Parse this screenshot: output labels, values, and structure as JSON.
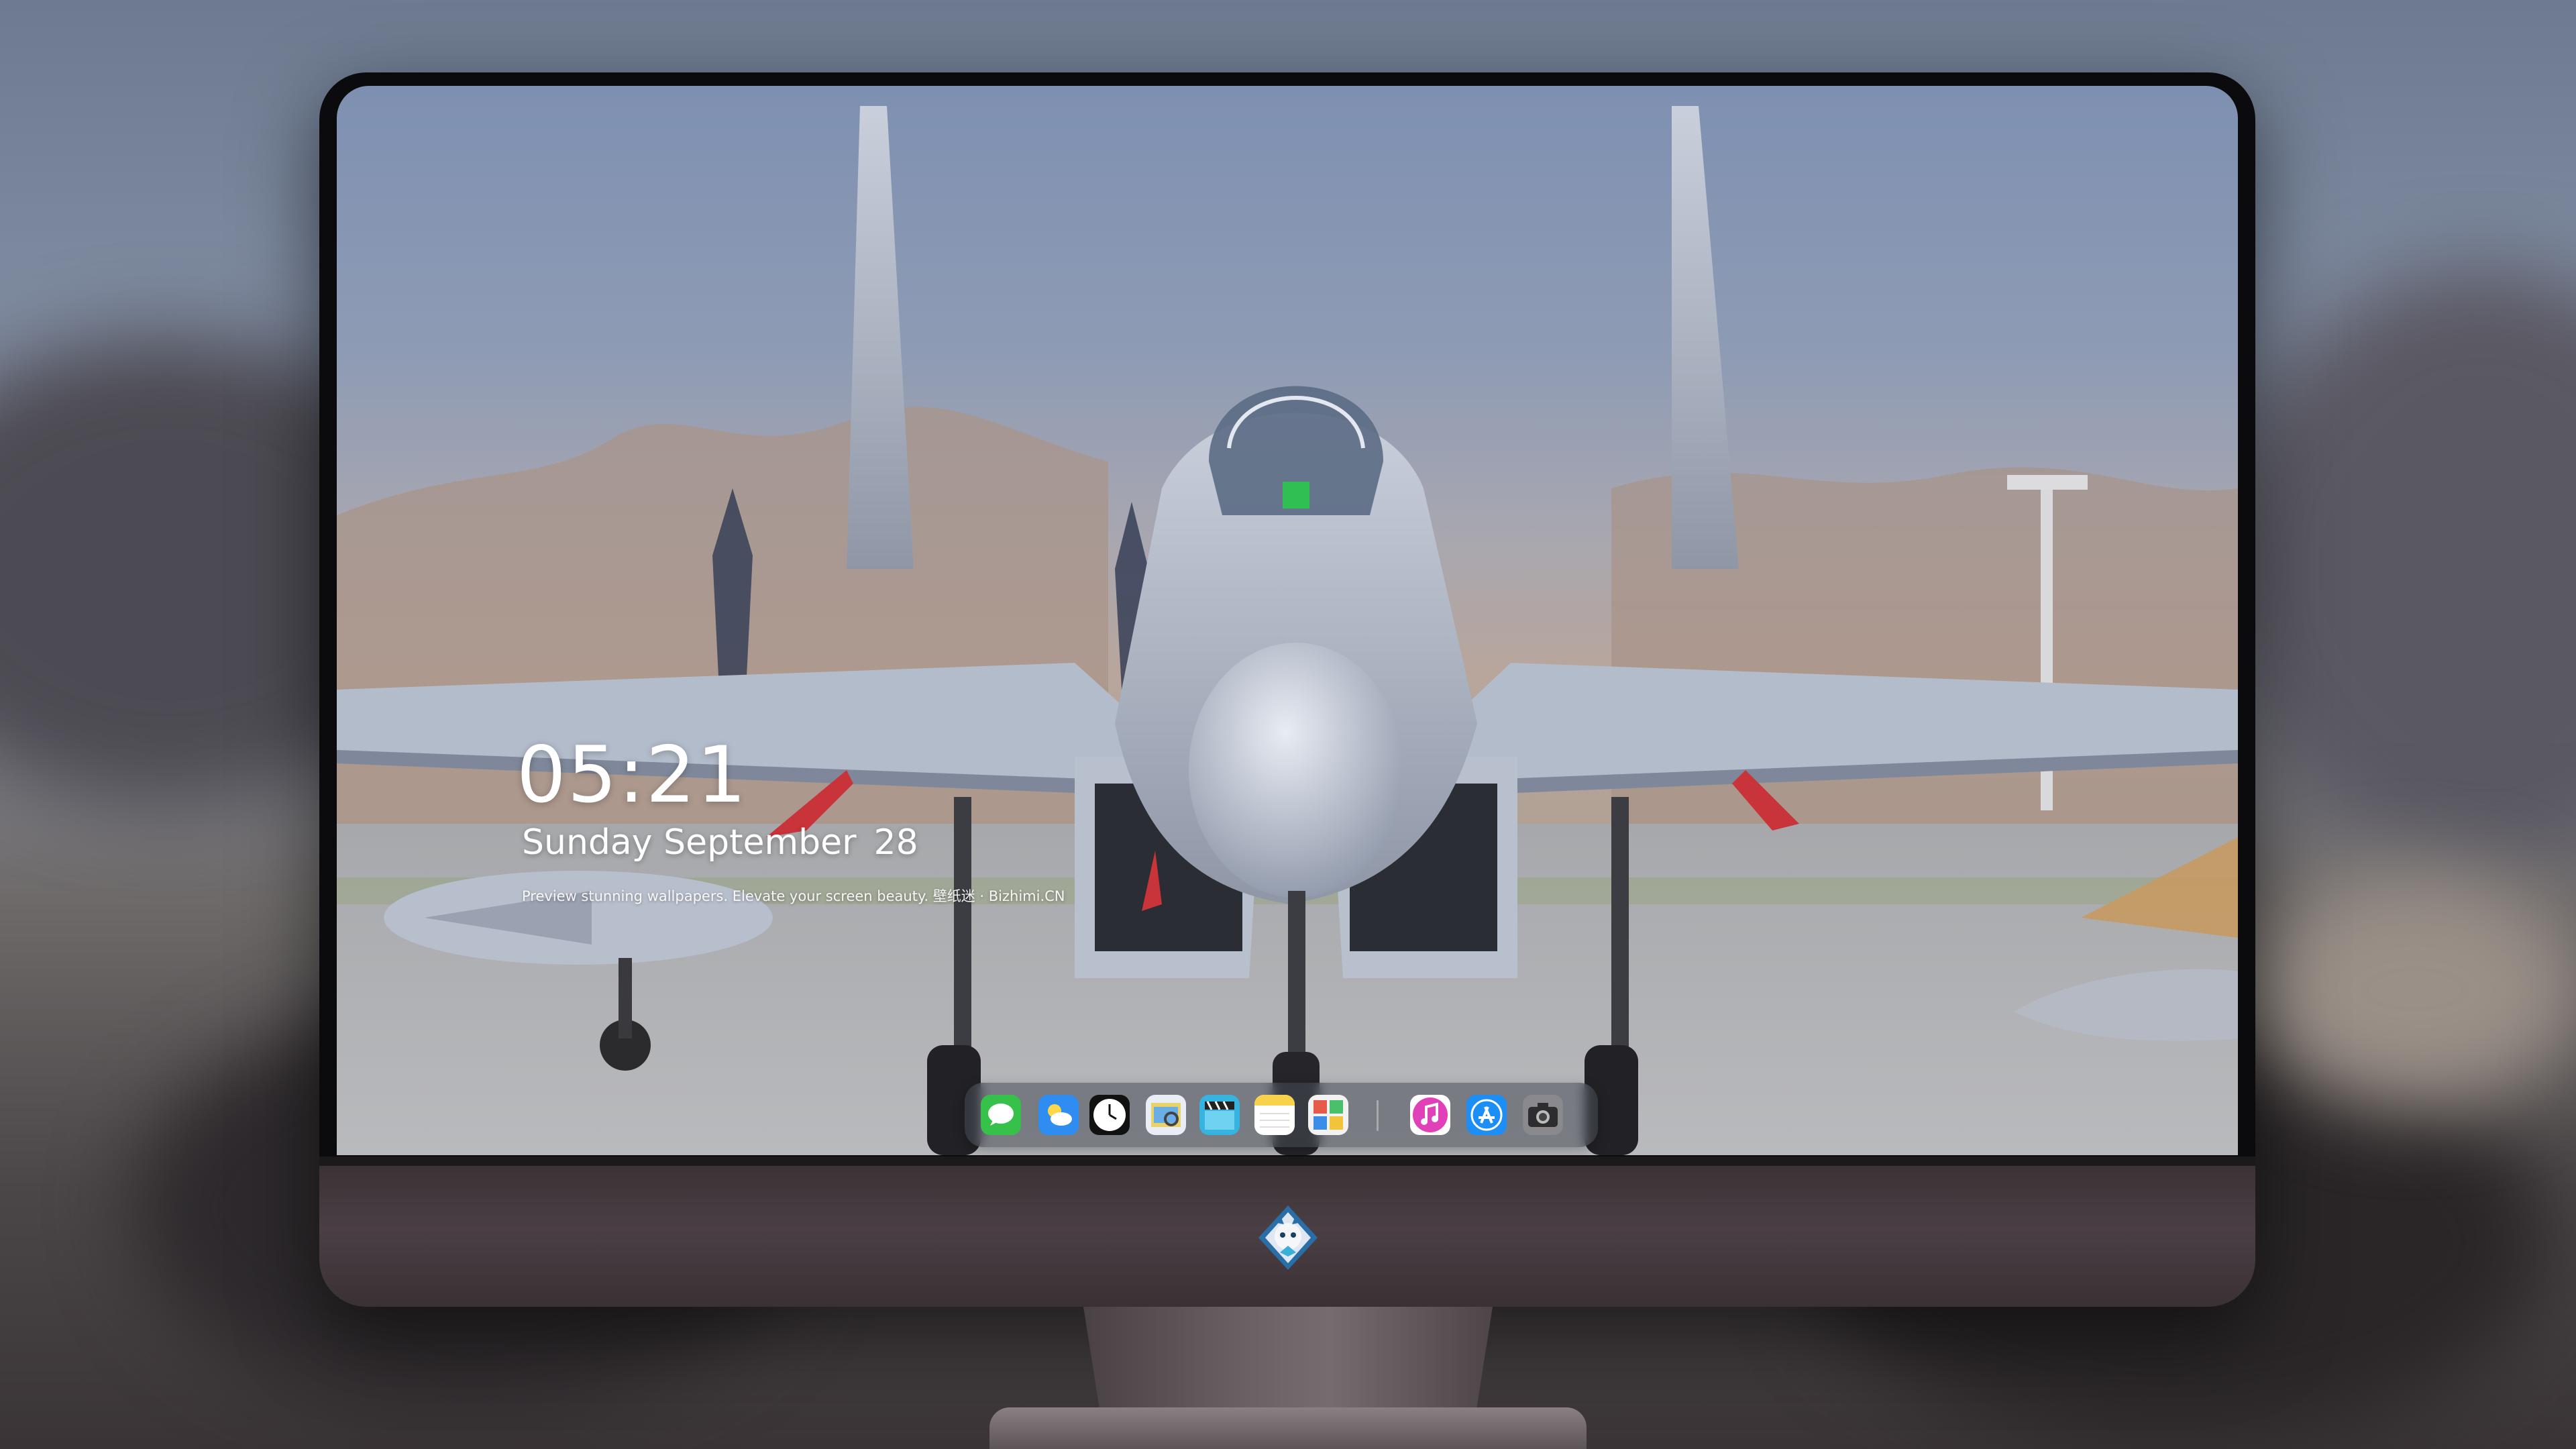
{
  "lockscreen": {
    "time": "05:21",
    "weekday_month": "Sunday September",
    "day": "28",
    "tagline": "Preview stunning wallpapers. Elevate your screen beauty. 壁纸迷 · Bizhimi.CN"
  },
  "dock": {
    "apps": [
      {
        "name": "messages-icon",
        "color": "#36c24a"
      },
      {
        "name": "weather-icon",
        "color": "#2f8cf0"
      },
      {
        "name": "clock-icon",
        "color": "#111111"
      },
      {
        "name": "preview-icon",
        "color": "#e8d36a"
      },
      {
        "name": "clips-icon",
        "color": "#37b3e0"
      },
      {
        "name": "notes-icon",
        "color": "#f7d24a"
      },
      {
        "name": "photo-booth-icon",
        "color": "#e65a4a"
      },
      {
        "name": "itunes-icon",
        "color": "#e040b8"
      },
      {
        "name": "app-store-icon",
        "color": "#1c8ef5"
      },
      {
        "name": "camera-icon",
        "color": "#8a8a8e"
      }
    ]
  },
  "monitor": {
    "bezel_color": "#0b0b0d",
    "chin_color": "#43393d",
    "logo": "dragon-mascot-logo"
  }
}
